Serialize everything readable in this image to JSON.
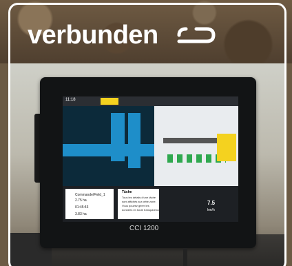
{
  "logo": {
    "text": "verbunden"
  },
  "device": {
    "brand_label": "CCI 1200"
  },
  "screen": {
    "time": "11:18",
    "task_title": "Tâche",
    "task_lines": [
      "Tous les détails d'une tâche",
      "sont affichés sur cette zone.",
      "Vous pouvez gérer les",
      "données en toute transparence"
    ],
    "field_name": "Commande/Field_1",
    "area": "2.75 ha",
    "duration": "01:45:43",
    "area2": "3.83 ha",
    "speed": "7.5",
    "speed_unit": "km/h"
  },
  "colors": {
    "screen_blue": "#1e8ec9",
    "accent_yellow": "#f4d21f",
    "accent_green": "#2fa84f"
  }
}
